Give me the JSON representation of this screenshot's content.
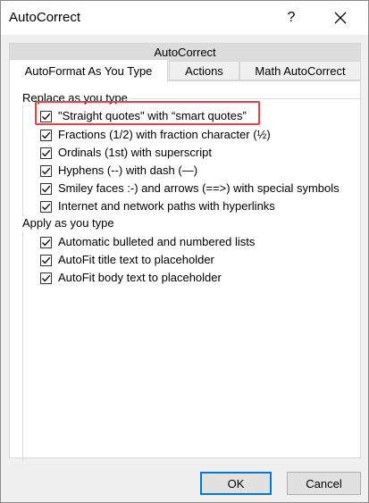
{
  "window": {
    "title": "AutoCorrect",
    "help_glyph": "?"
  },
  "tabs": {
    "upper": "AutoCorrect",
    "autoformat": "AutoFormat As You Type",
    "actions": "Actions",
    "math": "Math AutoCorrect"
  },
  "replace_section": {
    "label": "Replace as you type",
    "items": [
      {
        "label": "\"Straight quotes\" with “smart quotes”",
        "checked": true
      },
      {
        "label": "Fractions (1/2) with fraction character (½)",
        "checked": true
      },
      {
        "label": "Ordinals (1st) with superscript",
        "checked": true
      },
      {
        "label": "Hyphens (--) with dash (—)",
        "checked": true
      },
      {
        "label": "Smiley faces :-) and arrows (==>) with special symbols",
        "checked": true
      },
      {
        "label": "Internet and network paths with hyperlinks",
        "checked": true
      }
    ]
  },
  "apply_section": {
    "label": "Apply as you type",
    "items": [
      {
        "label": "Automatic bulleted and numbered lists",
        "checked": true
      },
      {
        "label": "AutoFit title text to placeholder",
        "checked": true
      },
      {
        "label": "AutoFit body text to placeholder",
        "checked": true
      }
    ]
  },
  "buttons": {
    "ok": "OK",
    "cancel": "Cancel"
  },
  "colors": {
    "highlight": "#e34545",
    "default_button_border": "#0078d7"
  }
}
